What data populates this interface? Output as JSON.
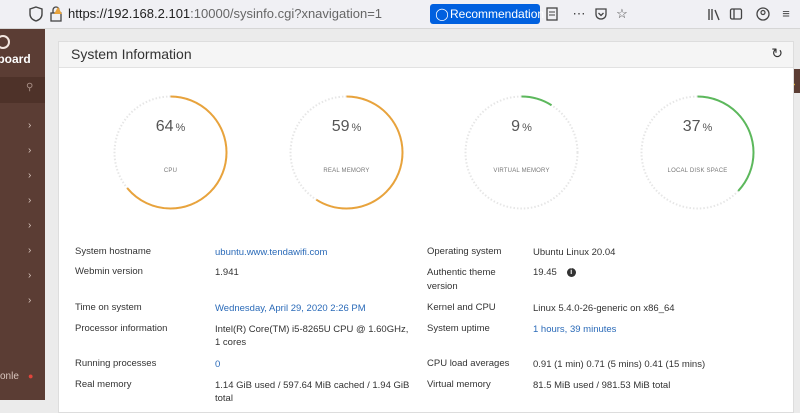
{
  "browser": {
    "url_host": "https://192.168.2.101",
    "url_path": ":10000/sysinfo.cgi?xnavigation=1",
    "recommendation_label": "Recommendation"
  },
  "sidebar": {
    "title": "oboard",
    "bottom_label": "onle"
  },
  "panel": {
    "title": "System Information"
  },
  "gauges": [
    {
      "value": "64",
      "unit": "%",
      "label": "CPU",
      "percent": 64,
      "color": "#e8a33c"
    },
    {
      "value": "59",
      "unit": "%",
      "label": "REAL MEMORY",
      "percent": 59,
      "color": "#e8a33c"
    },
    {
      "value": "9",
      "unit": "%",
      "label": "VIRTUAL MEMORY",
      "percent": 9,
      "color": "#5cb85c"
    },
    {
      "value": "37",
      "unit": "%",
      "label": "LOCAL DISK SPACE",
      "percent": 37,
      "color": "#5cb85c"
    }
  ],
  "info": {
    "hostname_label": "System hostname",
    "hostname_value": "ubuntu.www.tendawifi.com",
    "webmin_label": "Webmin version",
    "webmin_value": "1.941",
    "time_label": "Time on system",
    "time_value": "Wednesday, April 29, 2020 2:26 PM",
    "processor_label": "Processor information",
    "processor_value": "Intel(R) Core(TM) i5-8265U CPU @ 1.60GHz, 1 cores",
    "processes_label": "Running processes",
    "processes_value": "0",
    "realmem_label": "Real memory",
    "realmem_value": "1.14 GiB used / 597.64 MiB cached / 1.94 GiB total",
    "os_label": "Operating system",
    "os_value": "Ubuntu Linux 20.04",
    "theme_label": "Authentic theme version",
    "theme_value": "19.45",
    "kernel_label": "Kernel and CPU",
    "kernel_value": "Linux 5.4.0-26-generic on x86_64",
    "uptime_label": "System uptime",
    "uptime_value": "1 hours, 39 minutes",
    "load_label": "CPU load averages",
    "load_value": "0.91 (1 min) 0.71 (5 mins) 0.41 (15 mins)",
    "virtmem_label": "Virtual memory",
    "virtmem_value": "81.5 MiB used / 981.53 MiB total"
  },
  "colors": {
    "sidebar": "#5b3d34",
    "link": "#2a6ab8",
    "accent": "#0060df"
  }
}
